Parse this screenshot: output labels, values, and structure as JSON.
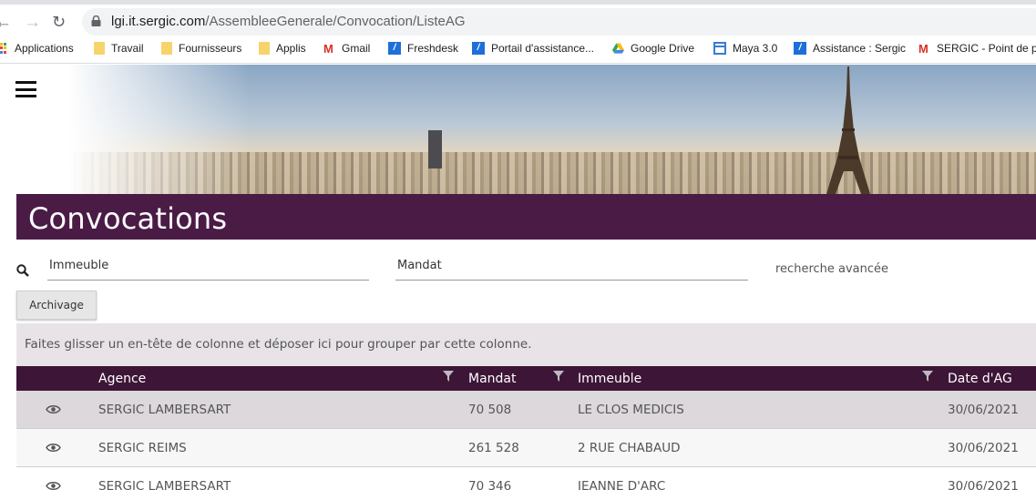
{
  "browser": {
    "url_host": "lgi.it.sergic.com",
    "url_path": "/AssembleeGenerale/Convocation/ListeAG",
    "bookmarks": [
      {
        "label": "Applications",
        "icon": "apps-grid-icon"
      },
      {
        "label": "Travail",
        "icon": "folder-icon"
      },
      {
        "label": "Fournisseurs",
        "icon": "folder-icon"
      },
      {
        "label": "Applis",
        "icon": "folder-icon"
      },
      {
        "label": "Gmail",
        "icon": "gmail-icon"
      },
      {
        "label": "Freshdesk",
        "icon": "freshdesk-icon"
      },
      {
        "label": "Portail d'assistance...",
        "icon": "freshdesk-icon"
      },
      {
        "label": "Google Drive",
        "icon": "google-drive-icon"
      },
      {
        "label": "Maya 3.0",
        "icon": "maya-icon"
      },
      {
        "label": "Assistance : Sergic",
        "icon": "freshdesk-icon"
      },
      {
        "label": "SERGIC - Point de p...",
        "icon": "gmail-icon"
      }
    ]
  },
  "page": {
    "title": "Convocations",
    "search": {
      "immeuble_placeholder": "Immeuble",
      "mandat_placeholder": "Mandat",
      "advanced_link": "recherche avancée"
    },
    "archive_button": "Archivage",
    "group_panel_text": "Faites glisser un en-tête de colonne et déposer ici pour grouper par cette colonne."
  },
  "grid": {
    "columns": [
      "Agence",
      "Mandat",
      "Immeuble",
      "Date d'AG"
    ],
    "rows": [
      {
        "agence": "SERGIC LAMBERSART",
        "mandat": "70 508",
        "immeuble": "LE CLOS MEDICIS",
        "date": "30/06/2021"
      },
      {
        "agence": "SERGIC REIMS",
        "mandat": "261 528",
        "immeuble": "2 RUE CHABAUD",
        "date": "30/06/2021"
      },
      {
        "agence": "SERGIC LAMBERSART",
        "mandat": "70 346",
        "immeuble": "JEANNE D'ARC",
        "date": "30/06/2021"
      }
    ]
  },
  "colors": {
    "title_bar": "#4a1b45",
    "grid_header": "#3d1537",
    "selected_row": "#dcd8db"
  }
}
